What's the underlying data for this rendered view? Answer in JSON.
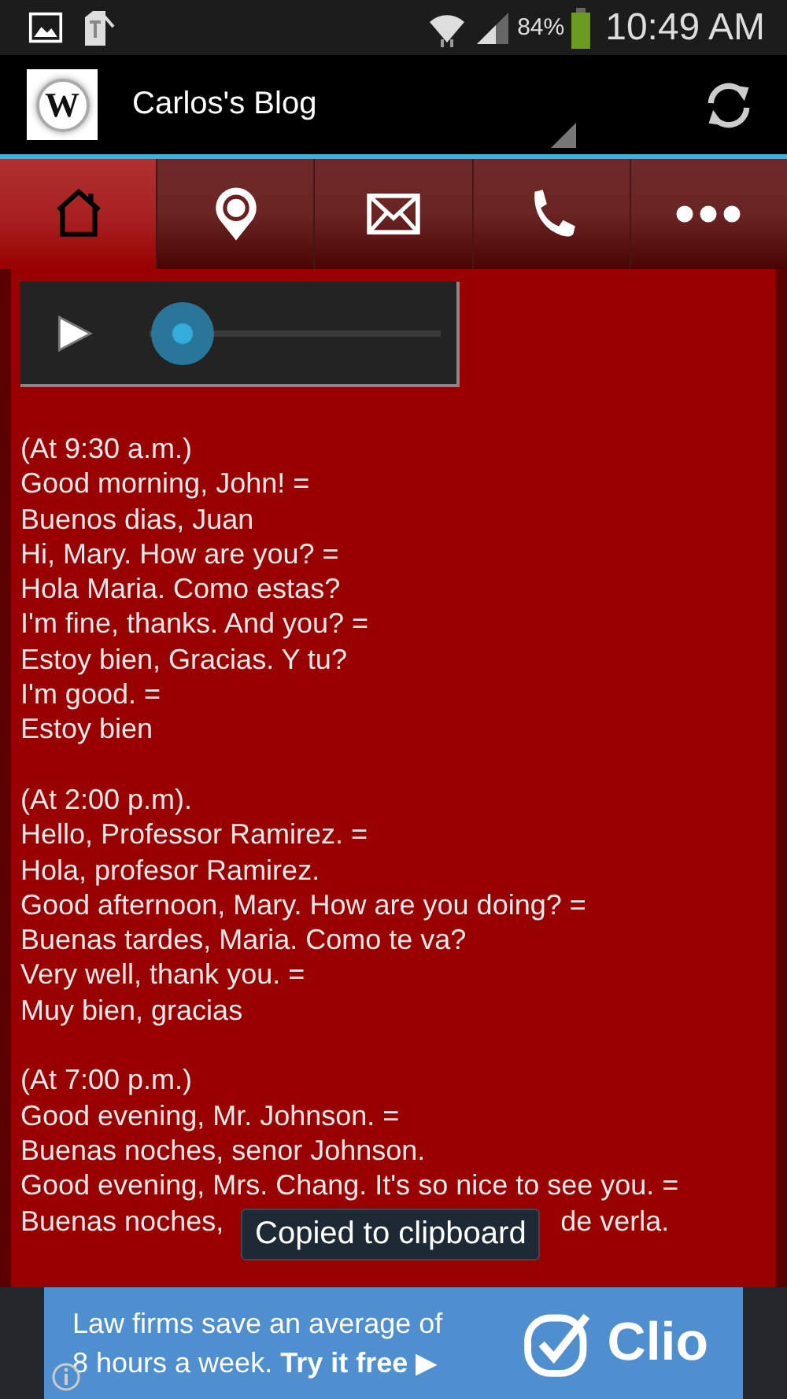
{
  "status_bar": {
    "battery": "84%",
    "time": "10:49 AM"
  },
  "app_bar": {
    "title": "Carlos's Blog",
    "logo_letter": "W"
  },
  "tabs": [
    {
      "kind": "home",
      "selected": true
    },
    {
      "kind": "pin",
      "selected": false
    },
    {
      "kind": "mail",
      "selected": false
    },
    {
      "kind": "phone",
      "selected": false
    },
    {
      "kind": "more",
      "selected": false
    }
  ],
  "player": {
    "seek": {
      "level": 0.1
    }
  },
  "transcript": [
    {
      "lines": [
        {
          "kind": "text",
          "text": "(At 9:30 a.m.)"
        },
        {
          "kind": "text",
          "text": "Good morning, John! ="
        },
        {
          "kind": "text",
          "text": "Buenos dias, Juan"
        },
        {
          "kind": "text",
          "text": "Hi, Mary. How are you? ="
        },
        {
          "kind": "text",
          "text": "Hola Maria. Como estas?"
        },
        {
          "kind": "text",
          "text": "I'm fine, thanks. And you? ="
        },
        {
          "kind": "text",
          "text": "Estoy bien, Gracias. Y tu?"
        },
        {
          "kind": "text",
          "text": "I'm good. ="
        },
        {
          "kind": "text",
          "text": "Estoy bien"
        }
      ]
    },
    {
      "lines": [
        {
          "kind": "text",
          "text": "(At 2:00 p.m)."
        },
        {
          "kind": "text",
          "text": "Hello, Professor Ramirez. ="
        },
        {
          "kind": "text",
          "text": "Hola, profesor Ramirez."
        },
        {
          "kind": "text",
          "text": "Good afternoon, Mary. How are you doing? ="
        },
        {
          "kind": "text",
          "text": "Buenas tardes, Maria. Como te va?"
        },
        {
          "kind": "text",
          "text": "Very well, thank you. ="
        },
        {
          "kind": "text",
          "text": "Muy bien, gracias"
        }
      ]
    },
    {
      "lines": [
        {
          "kind": "text",
          "text": "(At 7:00 p.m.)"
        },
        {
          "kind": "text",
          "text": "Good evening, Mr. Johnson. ="
        },
        {
          "kind": "text",
          "text": "Buenas noches, senor Johnson."
        },
        {
          "kind": "text",
          "text": "Good evening, Mrs. Chang. It's so nice to see you. ="
        },
        {
          "kind": "split",
          "parts": [
            "Buenas noches,",
            "de verla."
          ]
        }
      ]
    }
  ],
  "toast": {
    "text": "Copied to clipboard"
  },
  "ad": {
    "text": "Law firms save an average of\n8 hours a week. **Try it free** ▶",
    "brand": "Clio"
  }
}
